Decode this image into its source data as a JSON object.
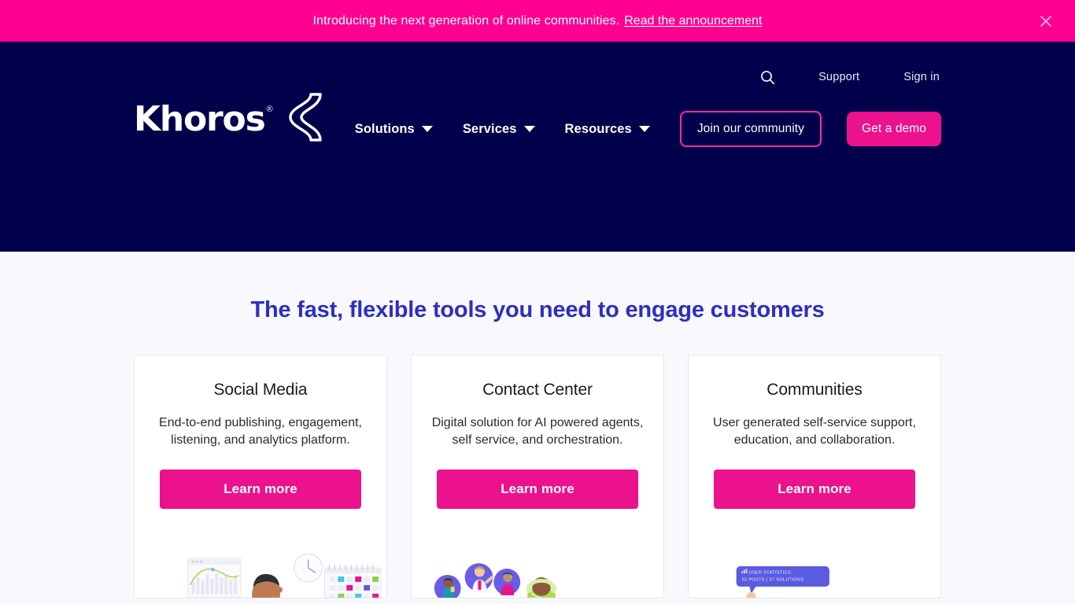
{
  "announcement": {
    "text": "Introducing the next generation of online communities.",
    "link_label": "Read the announcement",
    "close_icon": "close-icon",
    "background_color": "#FF0090"
  },
  "header": {
    "background_color": "#00004B",
    "brand": {
      "wordmark": "Khoros",
      "registered_mark": "®",
      "logo_icon": "khoros-logo-mark"
    },
    "utility": {
      "search_icon": "search-icon",
      "support_label": "Support",
      "signin_label": "Sign in"
    },
    "nav": [
      {
        "label": "Solutions",
        "caret_icon": "chevron-down-icon"
      },
      {
        "label": "Services",
        "caret_icon": "chevron-down-icon"
      },
      {
        "label": "Resources",
        "caret_icon": "chevron-down-icon"
      }
    ],
    "cta_outline_label": "Join our community",
    "cta_solid_label": "Get a demo",
    "accent_color": "#EC118C"
  },
  "main": {
    "section_title": "The fast, flexible tools you need to engage customers",
    "title_color": "#2D2FBE",
    "background_color": "#F8F8FD",
    "cards": [
      {
        "title": "Social Media",
        "description": "End-to-end publishing, engagement, listening, and analytics platform.",
        "cta_label": "Learn more",
        "art": "analytics-dashboard-person-clock-calendar-illustration"
      },
      {
        "title": "Contact Center",
        "description": "Digital solution for AI powered agents, self service, and orchestration.",
        "cta_label": "Learn more",
        "art": "agent-avatars-headset-illustration"
      },
      {
        "title": "Communities",
        "description": "User generated self-service support, education, and collaboration.",
        "cta_label": "Learn more",
        "art": "user-statistics-tooltip-illustration",
        "tooltip": {
          "heading": "USER STATISTICS:",
          "stats": "52 POSTS | 37 SOLUTIONS",
          "color": "#5B5BE0"
        }
      }
    ]
  }
}
